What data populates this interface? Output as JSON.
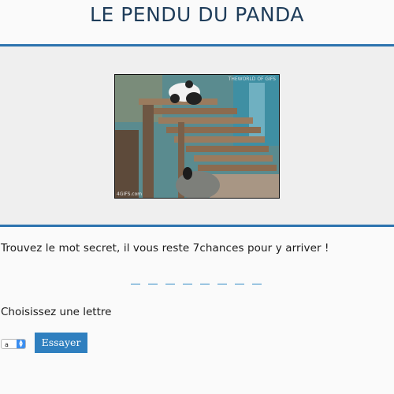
{
  "page": {
    "title": "LE PENDU DU PANDA"
  },
  "banner": {
    "image_name": "panda-gif",
    "watermark_text": "THEWORLD OF GIFS",
    "credit_text": "4GIFS.com"
  },
  "game": {
    "instruction": "Trouvez le mot secret, il vous reste 7chances pour y arriver !",
    "secret_word_length": 8,
    "choose_label": "Choisissez une lettre",
    "selected_letter": "a",
    "try_button_label": "Essayer"
  },
  "colors": {
    "accent": "#2c73ae",
    "title": "#1f3d5a",
    "button": "#2f7fbf",
    "dash": "#2f89c4"
  }
}
